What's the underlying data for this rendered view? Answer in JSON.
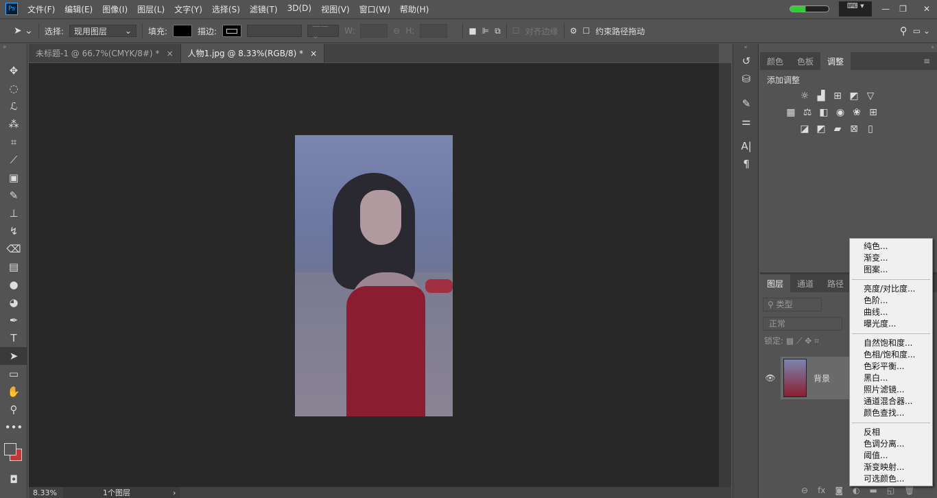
{
  "app": {
    "logo": "Ps"
  },
  "menu": [
    "文件(F)",
    "编辑(E)",
    "图像(I)",
    "图层(L)",
    "文字(Y)",
    "选择(S)",
    "滤镜(T)",
    "3D(D)",
    "视图(V)",
    "窗口(W)",
    "帮助(H)"
  ],
  "options": {
    "select_label": "选择:",
    "select_value": "现用图层",
    "fill_label": "填充:",
    "stroke_label": "描边:",
    "w_label": "W:",
    "h_label": "H:",
    "align_edges": "对齐边缘",
    "constrain": "约束路径拖动"
  },
  "tabs": [
    {
      "label": "未标题-1 @ 66.7%(CMYK/8#) *"
    },
    {
      "label": "人物1.jpg @ 8.33%(RGB/8) *"
    }
  ],
  "panel": {
    "tabs": [
      "颜色",
      "色板",
      "调整"
    ],
    "active_tab": "调整",
    "add_adjustment": "添加调整"
  },
  "layers": {
    "tabs": [
      "图层",
      "通道",
      "路径"
    ],
    "filter": "类型",
    "blend": "正常",
    "lock_label": "锁定:",
    "layer_name": "背景"
  },
  "context_menu": {
    "groups": [
      [
        "纯色...",
        "渐变...",
        "图案..."
      ],
      [
        "亮度/对比度...",
        "色阶...",
        "曲线...",
        "曝光度..."
      ],
      [
        "自然饱和度...",
        "色相/饱和度...",
        "色彩平衡...",
        "黑白...",
        "照片滤镜...",
        "通道混合器...",
        "颜色查找..."
      ],
      [
        "反相",
        "色调分离...",
        "阈值...",
        "渐变映射...",
        "可选颜色..."
      ]
    ]
  },
  "status": {
    "zoom": "8.33%",
    "layers": "1个图层"
  },
  "colors": {
    "accent": "#31a8ff",
    "canvas": "#282828",
    "dress": "#8a1e30"
  }
}
